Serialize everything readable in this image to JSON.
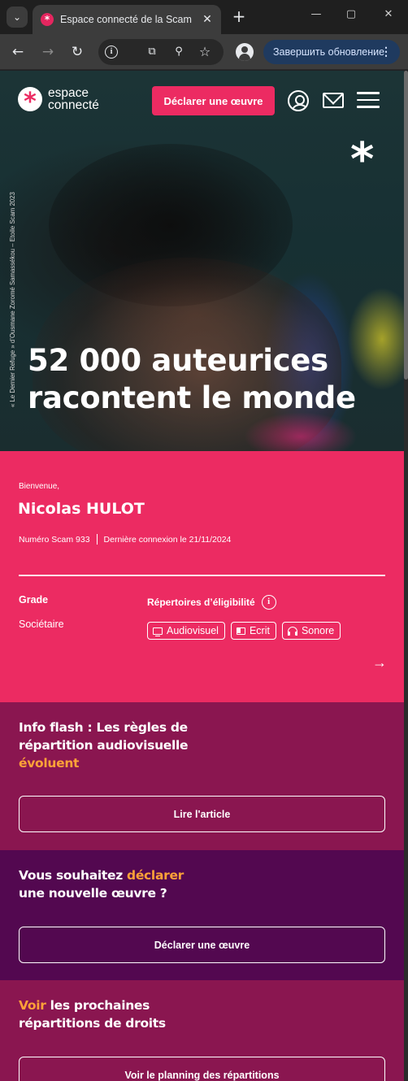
{
  "browser": {
    "tab_title": "Espace connecté de la Scam",
    "favicon_glyph": "*",
    "new_tab_glyph": "+",
    "close_glyph": "✕",
    "update_button_label": "Завершить обновление",
    "window_controls": [
      "—",
      "▢",
      "✕"
    ]
  },
  "header": {
    "logo_line1": "espace",
    "logo_line2": "connecté",
    "declare_button": "Déclarer une œuvre"
  },
  "hero": {
    "credit": "« Le Dernier Refuge » d’Ousmane Zoromé Samassékou – Etoile Scam 2023",
    "title": "52 000 auteurices racontent le monde"
  },
  "welcome": {
    "greeting": "Bienvenue,",
    "name": "Nicolas HULOT",
    "member_number": "Numéro Scam 933",
    "last_login": "Dernière connexion le 21/11/2024",
    "grade_label": "Grade",
    "grade_value": "Sociétaire",
    "repertoires_label": "Répertoires d’éligibilité",
    "tags": [
      {
        "label": "Audiovisuel",
        "icon": "tv-icon"
      },
      {
        "label": "Ecrit",
        "icon": "book-icon"
      },
      {
        "label": "Sonore",
        "icon": "headphones-icon"
      }
    ]
  },
  "info_flash": {
    "title_part1": "Info flash : Les règles de répartition audiovisuelle",
    "title_accent": "évoluent",
    "button": "Lire l'article"
  },
  "declare_section": {
    "title_part1": "Vous souhaitez",
    "title_accent": "déclarer",
    "title_part2": "une nouvelle œuvre ?",
    "button": "Déclarer une œuvre"
  },
  "repartitions": {
    "title_accent": "Voir",
    "title_part1": "les prochaines",
    "title_part2": "répartitions de droits",
    "button": "Voir le planning des répartitions"
  },
  "colors": {
    "brand_pink": "#ec2b62",
    "section_wine": "#8a1650",
    "section_purple": "#530850",
    "accent_orange": "#ffa238"
  }
}
